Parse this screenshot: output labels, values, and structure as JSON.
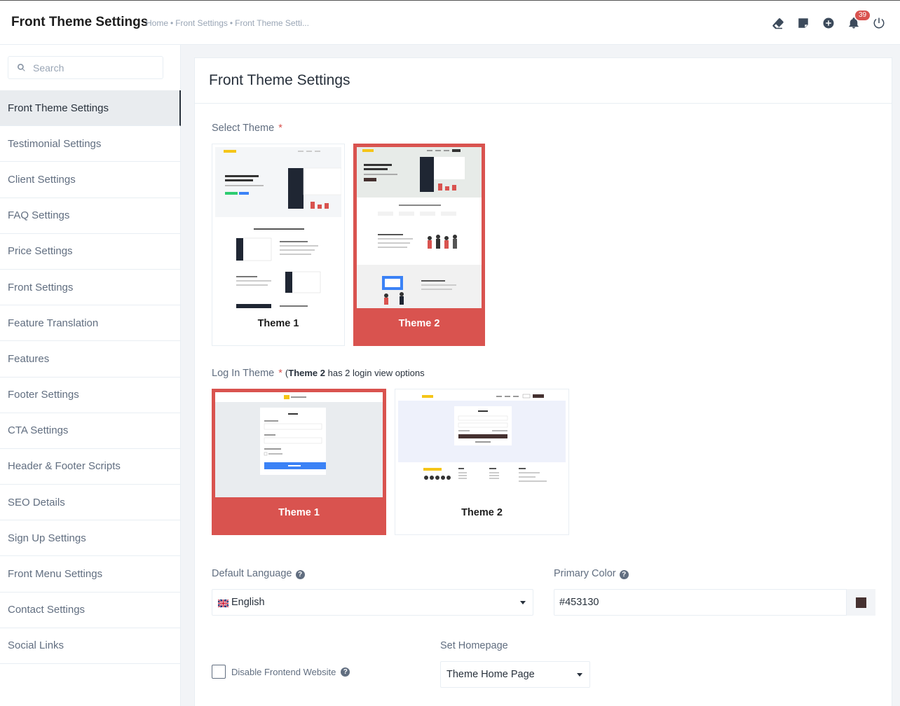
{
  "header": {
    "title": "Front Theme Settings",
    "breadcrumb": [
      "Home",
      "Front Settings",
      "Front Theme Setti..."
    ],
    "notification_count": "39",
    "icons": [
      "eraser-icon",
      "sticky-note-icon",
      "plus-circle-icon",
      "bell-icon",
      "power-icon"
    ]
  },
  "sidebar": {
    "search_placeholder": "Search",
    "items": [
      {
        "label": "Front Theme Settings"
      },
      {
        "label": "Testimonial Settings"
      },
      {
        "label": "Client Settings"
      },
      {
        "label": "FAQ Settings"
      },
      {
        "label": "Price Settings"
      },
      {
        "label": "Front Settings"
      },
      {
        "label": "Feature Translation"
      },
      {
        "label": "Features"
      },
      {
        "label": "Footer Settings"
      },
      {
        "label": "CTA Settings"
      },
      {
        "label": "Header & Footer Scripts"
      },
      {
        "label": "SEO Details"
      },
      {
        "label": "Sign Up Settings"
      },
      {
        "label": "Front Menu Settings"
      },
      {
        "label": "Contact Settings"
      },
      {
        "label": "Social Links"
      }
    ]
  },
  "main": {
    "title": "Front Theme Settings",
    "select_theme_label": "Select Theme",
    "required_mark": "*",
    "themes": [
      {
        "label": "Theme 1",
        "selected": false
      },
      {
        "label": "Theme 2",
        "selected": true
      }
    ],
    "login_theme_label": "Log In Theme",
    "login_note_open": "(",
    "login_note_bold": "Theme 2",
    "login_note_rest": " has 2 login view options",
    "login_themes": [
      {
        "label": "Theme 1",
        "selected": true
      },
      {
        "label": "Theme 2",
        "selected": false
      }
    ],
    "default_language_label": "Default Language",
    "default_language_value": "English",
    "primary_color_label": "Primary Color",
    "primary_color_value": "#453130",
    "primary_color_swatch": "#453130",
    "set_homepage_label": "Set Homepage",
    "set_homepage_value": "Theme Home Page",
    "disable_frontend_label": "Disable Frontend Website",
    "accent_color": "#d9534f"
  }
}
